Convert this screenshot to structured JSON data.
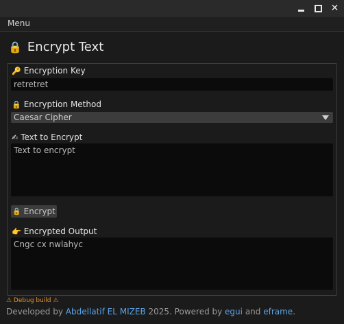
{
  "menu": {
    "label": "Menu"
  },
  "heading": {
    "icon": "🔒",
    "title": "Encrypt Text"
  },
  "key": {
    "icon": "🔑",
    "label": "Encryption Key",
    "value": "retretret"
  },
  "method": {
    "icon": "🔒",
    "label": "Encryption Method",
    "selected": "Caesar Cipher"
  },
  "input": {
    "icon": "✍",
    "label": "Text to Encrypt",
    "value": "Text to encrypt"
  },
  "encrypt_button": {
    "icon": "🔒",
    "label": "Encrypt"
  },
  "output": {
    "icon": "👉",
    "label": "Encrypted Output",
    "value": "Cngc cx nwlahyc"
  },
  "debug": {
    "text": "⚠ Debug build ⚠"
  },
  "footer": {
    "prefix": "Developed by ",
    "author": "Abdellatif EL MIZEB",
    "middle": " 2025. Powered by ",
    "lib1": "egui",
    "and": " and ",
    "lib2": "eframe",
    "suffix": "."
  },
  "colors": {
    "link": "#5aa5e8",
    "warning": "#e8922c",
    "background": "#1b1b1b"
  }
}
